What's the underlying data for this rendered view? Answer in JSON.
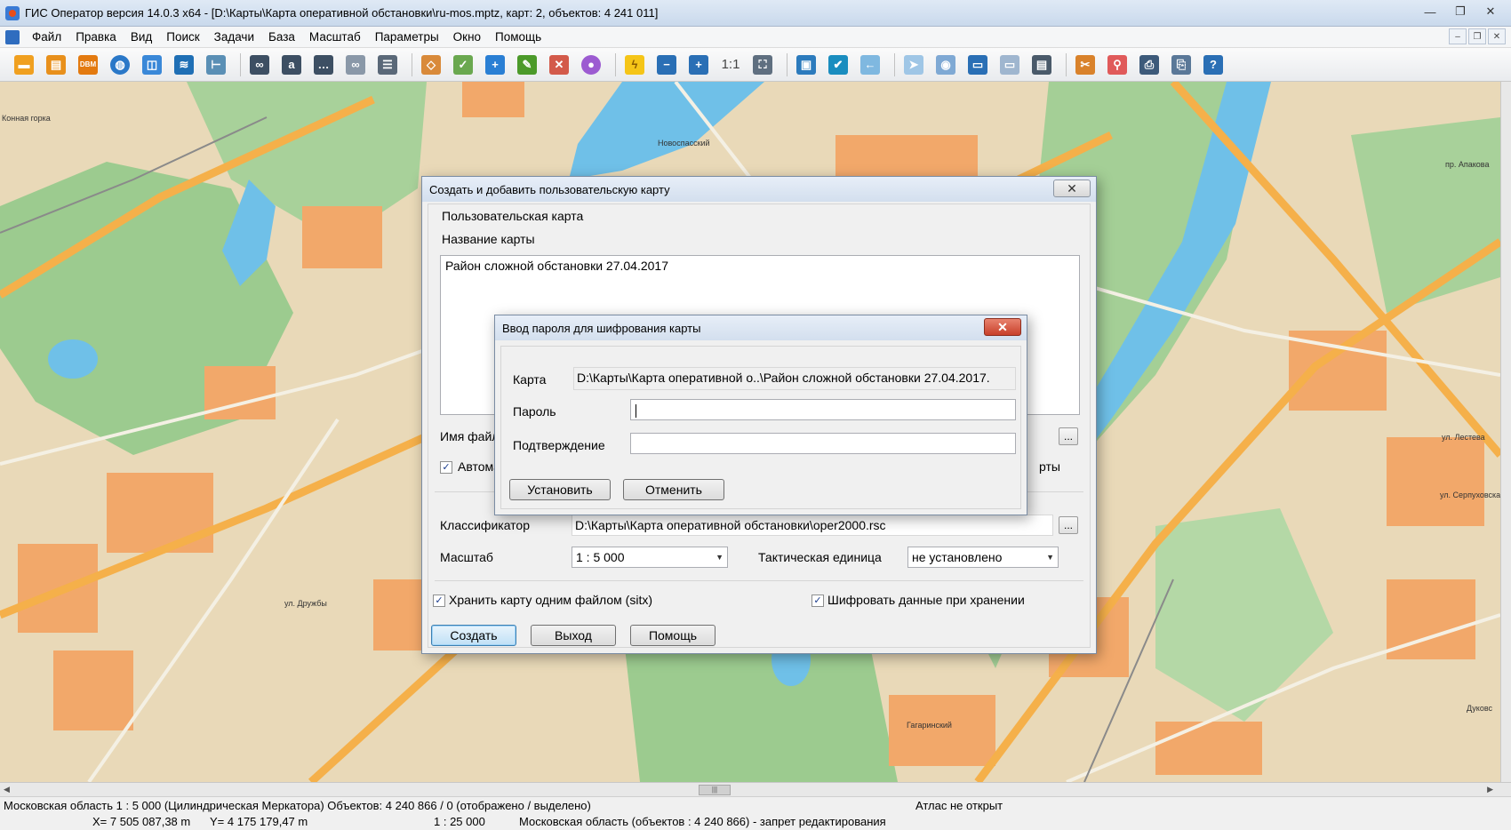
{
  "window": {
    "title": "ГИС Оператор версия 14.0.3 x64 - [D:\\Карты\\Карта оперативной обстановки\\ru-mos.mptz, карт: 2, объектов: 4 241 011]",
    "minimize": "—",
    "maximize": "❐",
    "close": "✕"
  },
  "menu": {
    "items": [
      "Файл",
      "Правка",
      "Вид",
      "Поиск",
      "Задачи",
      "База",
      "Масштаб",
      "Параметры",
      "Окно",
      "Помощь"
    ]
  },
  "toolbar": {
    "scale_1to1": "1:1"
  },
  "map": {
    "labels": [
      "Конная горка",
      "ул. Лестева",
      "ул. Серпуховская",
      "пр. Апакова",
      "ул. Дружбы",
      "Гагаринский",
      "Дуковс",
      "Новоспасский"
    ],
    "colors": {
      "base": "#e9d9b8",
      "buildings": "#f2a86a",
      "parks": "#9ccb8f",
      "water": "#6fc0e8",
      "roads": "#f4f0e4",
      "arterial": "#f5b04a"
    }
  },
  "status": {
    "line1_left": "Московская область   1 : 5 000 (Цилиндрическая Меркатора) Объектов: 4 240 866 / 0 (отображено / выделено)",
    "line1_right": "Атлас не открыт",
    "coord_x": "X= 7 505 087,38 m",
    "coord_y": "Y= 4 175 179,47 m",
    "scale": "1 : 25 000",
    "line2_right": "Московская область   (объектов : 4 240 866) - запрет редактирования"
  },
  "create_dialog": {
    "title": "Создать и добавить пользовательскую карту",
    "close": "✕",
    "group_label": "Пользовательская карта",
    "name_label": "Название карты",
    "name_value": "Район сложной обстановки 27.04.2017",
    "file_label": "Имя файл",
    "auto_label": "Автома",
    "card_suffix": "рты",
    "browse": "...",
    "classifier_label": "Классификатор",
    "classifier_value": "D:\\Карты\\Карта оперативной обстановки\\oper2000.rsc",
    "scale_label": "Масштаб",
    "scale_value": "1 : 5 000",
    "unit_label": "Тактическая единица",
    "unit_value": "не установлено",
    "store_single_label": "Хранить карту одним файлом (sitx)",
    "encrypt_label": "Шифровать данные при хранении",
    "create_btn": "Создать",
    "exit_btn": "Выход",
    "help_btn": "Помощь",
    "check_mark": "✓"
  },
  "password_dialog": {
    "title": "Ввод пароля для шифрования карты",
    "close": "✕",
    "map_label": "Карта",
    "map_value": "D:\\Карты\\Карта оперативной о..\\Район сложной обстановки 27.04.2017.",
    "password_label": "Пароль",
    "password_value": "",
    "confirm_label": "Подтверждение",
    "confirm_value": "",
    "set_btn": "Установить",
    "cancel_btn": "Отменить"
  }
}
